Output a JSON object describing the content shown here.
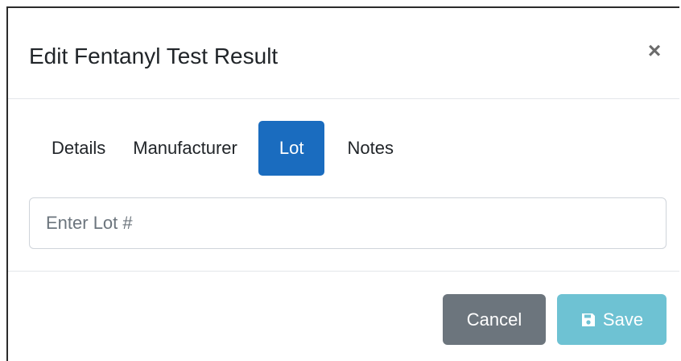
{
  "modal": {
    "title": "Edit Fentanyl Test Result",
    "close_label": "×"
  },
  "tabs": [
    {
      "label": "Details",
      "active": false
    },
    {
      "label": "Manufacturer",
      "active": false
    },
    {
      "label": "Lot",
      "active": true
    },
    {
      "label": "Notes",
      "active": false
    }
  ],
  "lot_field": {
    "placeholder": "Enter Lot #",
    "value": ""
  },
  "footer": {
    "cancel_label": "Cancel",
    "save_label": "Save",
    "save_icon": "floppy-disk-icon"
  },
  "colors": {
    "active_tab": "#1a6cbf",
    "cancel": "#6c757d",
    "save": "#6ec2d3"
  }
}
